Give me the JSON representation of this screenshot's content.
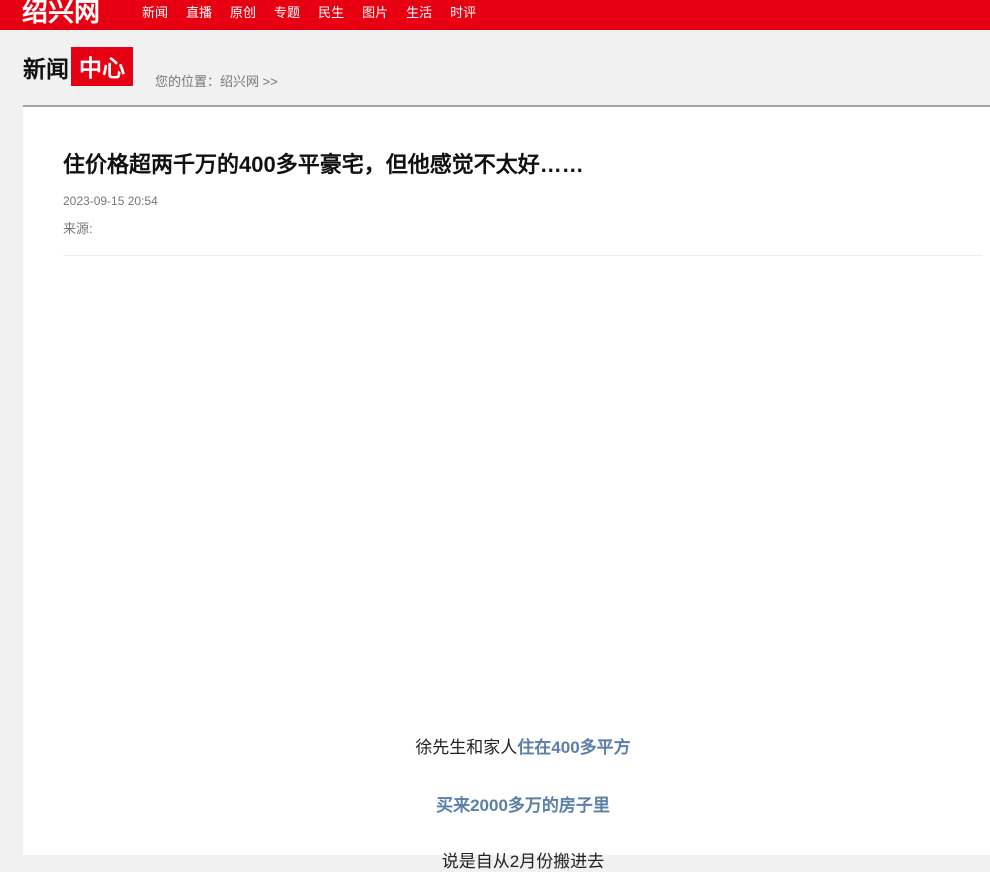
{
  "header": {
    "logo": "绍兴网",
    "nav": [
      "新闻",
      "直播",
      "原创",
      "专题",
      "民生",
      "图片",
      "生活",
      "时评"
    ]
  },
  "section": {
    "title_plain": "新闻",
    "title_box": "中心"
  },
  "breadcrumb": {
    "label": "您的位置：",
    "link": "绍兴网",
    "separator": " >>"
  },
  "article": {
    "title": "住价格超两千万的400多平豪宅，但他感觉不太好……",
    "date": "2023-09-15 20:54",
    "source_label": "来源:",
    "paragraphs": [
      {
        "plain": "徐先生和家人",
        "highlight": "住在400多平方"
      },
      {
        "plain": "",
        "highlight": "买来2000多万的房子里"
      },
      {
        "plain": "说是自从2月份搬进去",
        "highlight": ""
      }
    ]
  },
  "colors": {
    "brand_red": "#e60012",
    "highlight_blue": "#5b7fa6",
    "page_bg": "#f1f1f1"
  }
}
